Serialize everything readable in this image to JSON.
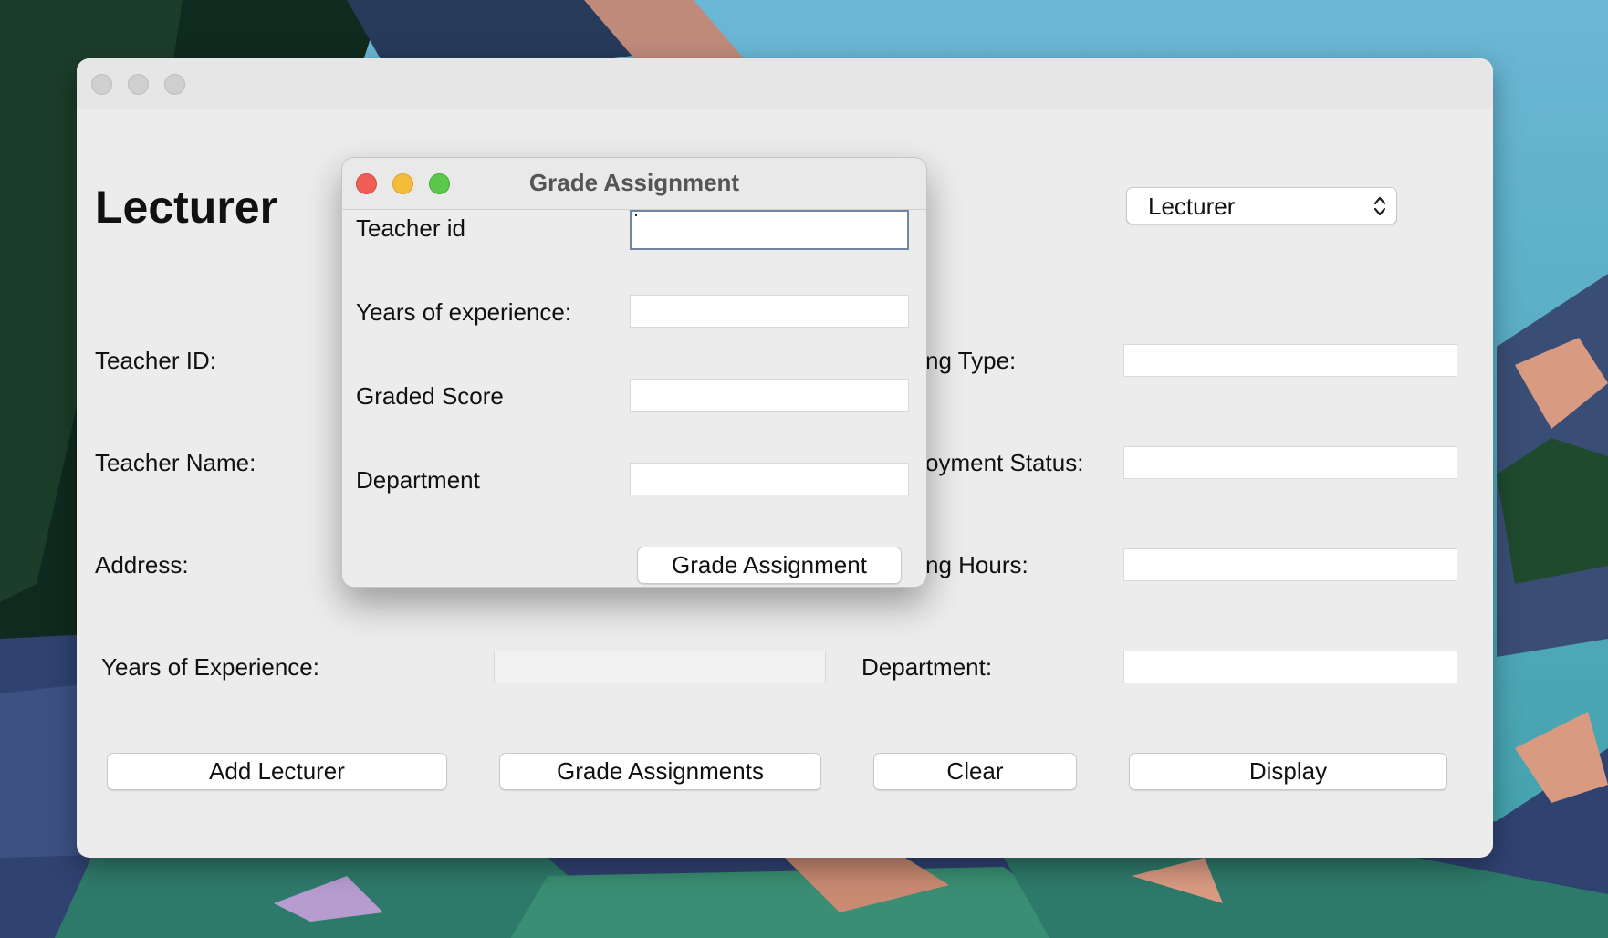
{
  "main_window": {
    "heading": "Lecturer",
    "role_select": {
      "selected": "Lecturer"
    },
    "labels": {
      "teacher_id": "Teacher ID:",
      "teacher_name": "Teacher Name:",
      "address": "Address:",
      "years_experience": "Years of Experience:",
      "working_type_partial": "ng Type:",
      "employment_status_partial": "oyment Status:",
      "working_hours_partial": "ng Hours:",
      "department": "Department:"
    },
    "buttons": {
      "add_lecturer": "Add Lecturer",
      "grade_assignments": "Grade Assignments",
      "clear": "Clear",
      "display": "Display"
    }
  },
  "dialog": {
    "title": "Grade Assignment",
    "labels": {
      "teacher_id": "Teacher id",
      "years_experience": "Years of experience:",
      "graded_score": "Graded Score",
      "department": "Department"
    },
    "submit_button": "Grade Assignment"
  },
  "colors": {
    "close": "#ee5e56",
    "minimize": "#f4bc3a",
    "zoom": "#5ac84a",
    "window_bg": "#ececec",
    "focus_border": "#6f86a6"
  }
}
